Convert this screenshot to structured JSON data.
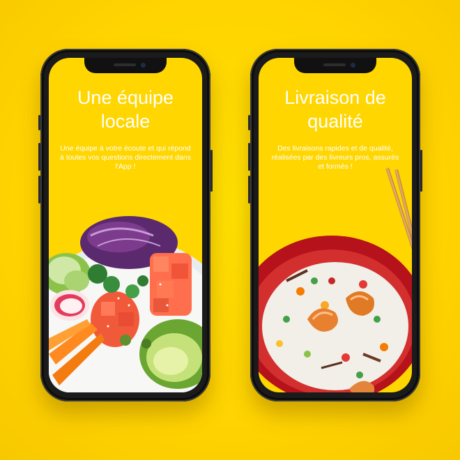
{
  "background_color": "#ffd600",
  "screens": [
    {
      "title": "Une équipe locale",
      "description": "Une équipe à votre écoute et qui répond à toutes vos questions directement dans l'App !",
      "image": "poke-bowl-photo"
    },
    {
      "title": "Livraison de qualité",
      "description": "Des livraisons rapides et de qualité, réalisées par des livreurs pros, assurés et formés !",
      "image": "shrimp-fried-rice-photo"
    }
  ]
}
